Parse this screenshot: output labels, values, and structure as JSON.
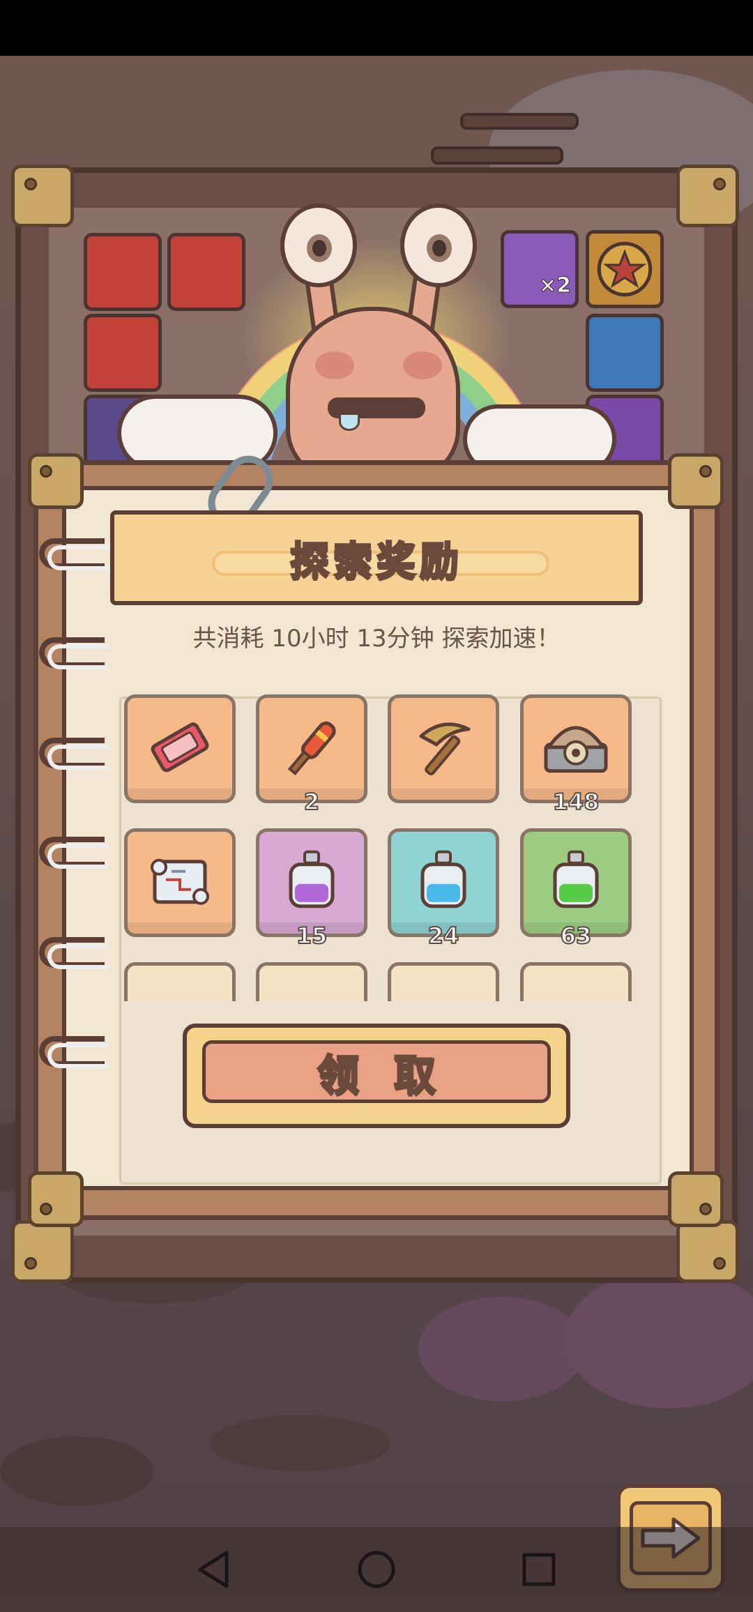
{
  "dialog": {
    "title": "探索奖励",
    "subtitle": "共消耗  10小时  13分钟  探索加速！",
    "claim_label": "领取"
  },
  "rewards": [
    {
      "icon": "ticket-icon",
      "bg": "#f6b98a",
      "qty": ""
    },
    {
      "icon": "firework-stick-icon",
      "bg": "#f6b98a",
      "qty": "2"
    },
    {
      "icon": "pickaxe-icon",
      "bg": "#f6b98a",
      "qty": ""
    },
    {
      "icon": "machine-chest-icon",
      "bg": "#f6b98a",
      "qty": "148"
    },
    {
      "icon": "treasure-map-icon",
      "bg": "#f6b98a",
      "qty": ""
    },
    {
      "icon": "purple-potion-icon",
      "bg": "#d7a9d3",
      "qty": "15"
    },
    {
      "icon": "blue-potion-icon",
      "bg": "#8fd3d3",
      "qty": "24"
    },
    {
      "icon": "green-potion-icon",
      "bg": "#9ccc82",
      "qty": "63"
    }
  ],
  "background_tiles": {
    "badge_text": "×2"
  },
  "colors": {
    "wood": "#b48462",
    "paper": "#f1e6d2",
    "outline": "#5b3e35",
    "banner": "#f6d294",
    "button": "#e9a286"
  },
  "nav": {
    "back_icon": "triangle-back-icon",
    "home_icon": "circle-home-icon",
    "recents_icon": "square-recents-icon"
  }
}
